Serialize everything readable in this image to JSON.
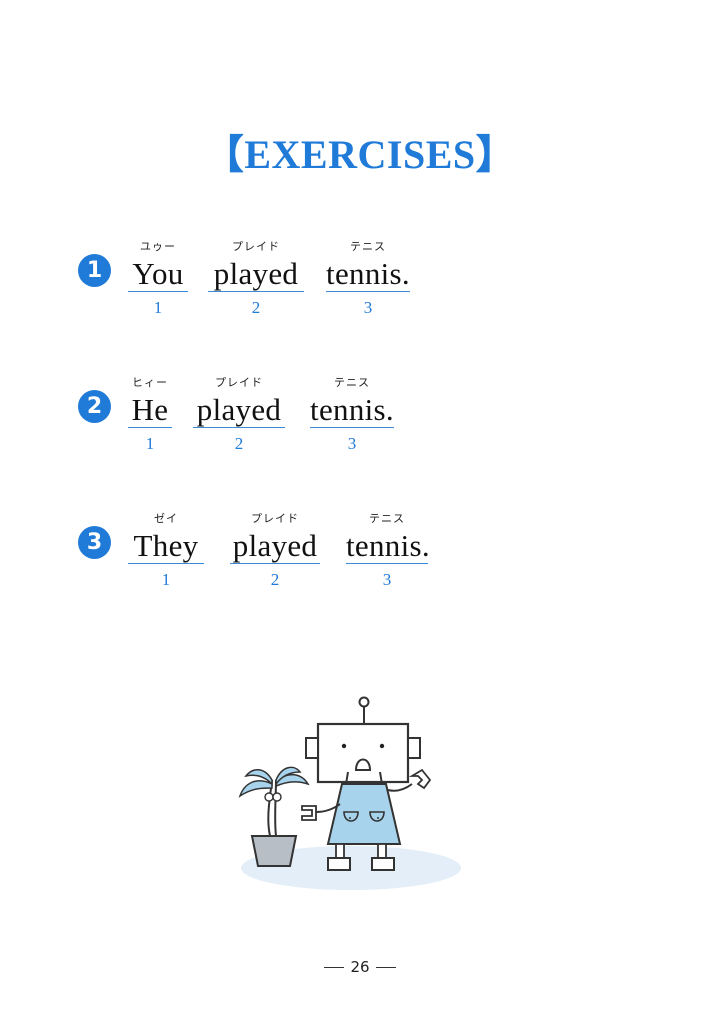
{
  "title": "【EXERCISES】",
  "exercises": [
    {
      "badge": "1",
      "words": [
        {
          "kana": "ユゥー",
          "text": "You",
          "num": "1"
        },
        {
          "kana": "プレイド",
          "text": "played",
          "num": "2"
        },
        {
          "kana": "テニス",
          "text": "tennis.",
          "num": "3"
        }
      ]
    },
    {
      "badge": "2",
      "words": [
        {
          "kana": "ヒィー",
          "text": "He",
          "num": "1"
        },
        {
          "kana": "プレイド",
          "text": "played",
          "num": "2"
        },
        {
          "kana": "テニス",
          "text": "tennis.",
          "num": "3"
        }
      ]
    },
    {
      "badge": "3",
      "words": [
        {
          "kana": "ゼイ",
          "text": "They",
          "num": "1"
        },
        {
          "kana": "プレイド",
          "text": "played",
          "num": "2"
        },
        {
          "kana": "テニス",
          "text": "tennis.",
          "num": "3"
        }
      ]
    }
  ],
  "page_number": "26",
  "colors": {
    "accent": "#1f7ad8",
    "text": "#111111"
  },
  "illustration": {
    "icon": "robot-with-potted-palm-icon"
  }
}
